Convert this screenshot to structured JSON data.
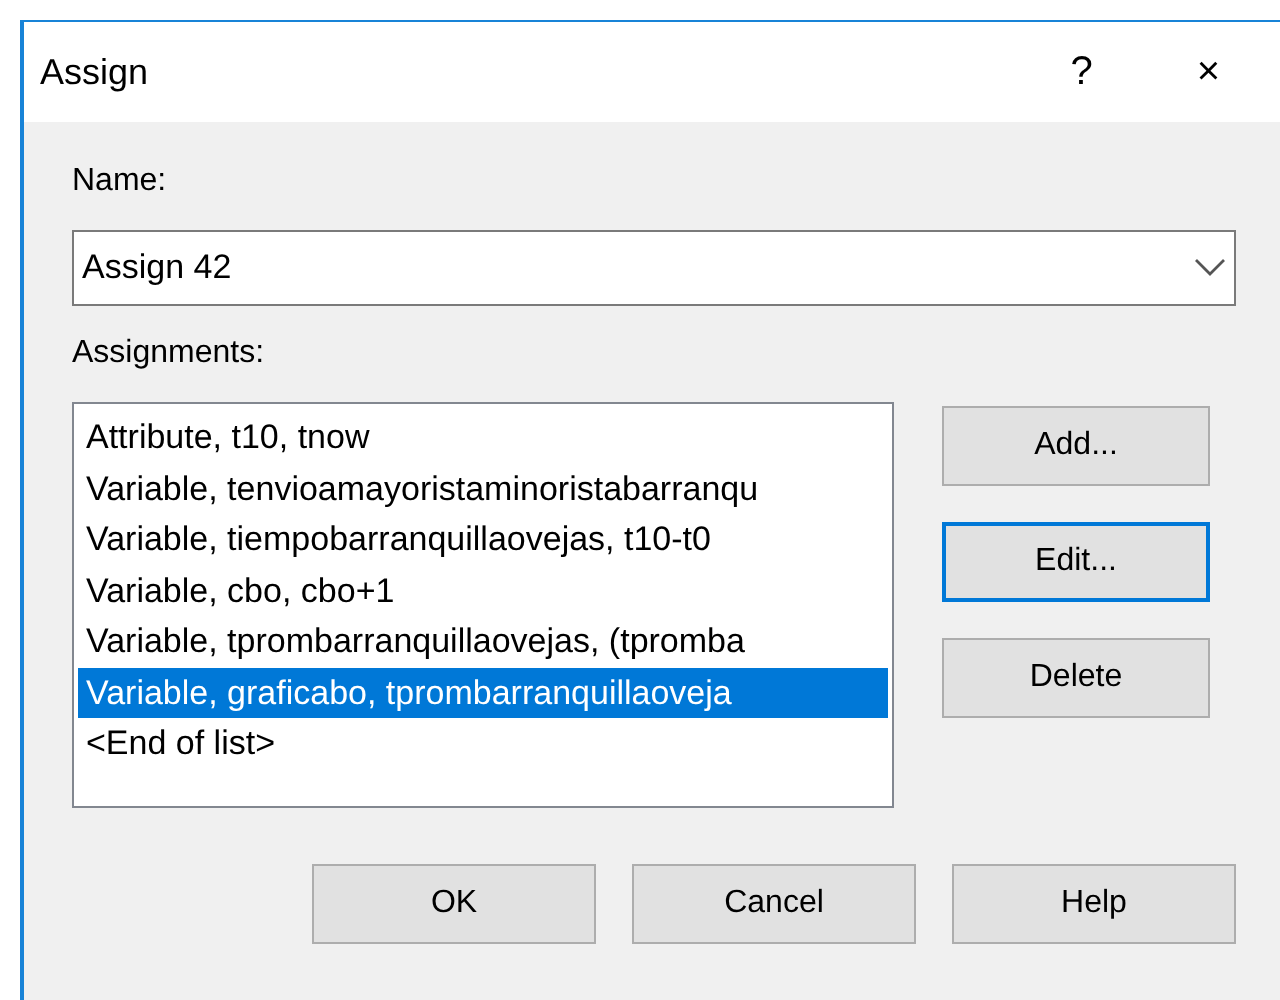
{
  "window": {
    "title": "Assign",
    "help_button": "?",
    "close_button": "×"
  },
  "name": {
    "label": "Name:",
    "value": "Assign 42"
  },
  "assignments": {
    "label": "Assignments:",
    "items": [
      {
        "text": "Attribute, t10, tnow",
        "selected": false
      },
      {
        "text": "Variable, tenvioamayoristaminoristabarranqu",
        "selected": false
      },
      {
        "text": "Variable, tiempobarranquillaovejas, t10-t0",
        "selected": false
      },
      {
        "text": "Variable, cbo, cbo+1",
        "selected": false
      },
      {
        "text": "Variable, tprombarranquillaovejas, (tpromba",
        "selected": false
      },
      {
        "text": "Variable, graficabo, tprombarranquillaoveja",
        "selected": true
      },
      {
        "text": "<End of list>",
        "selected": false
      }
    ]
  },
  "side_buttons": [
    {
      "label": "Add...",
      "focused": false
    },
    {
      "label": "Edit...",
      "focused": true
    },
    {
      "label": "Delete",
      "focused": false
    }
  ],
  "buttons": [
    "OK",
    "Cancel",
    "Help"
  ]
}
